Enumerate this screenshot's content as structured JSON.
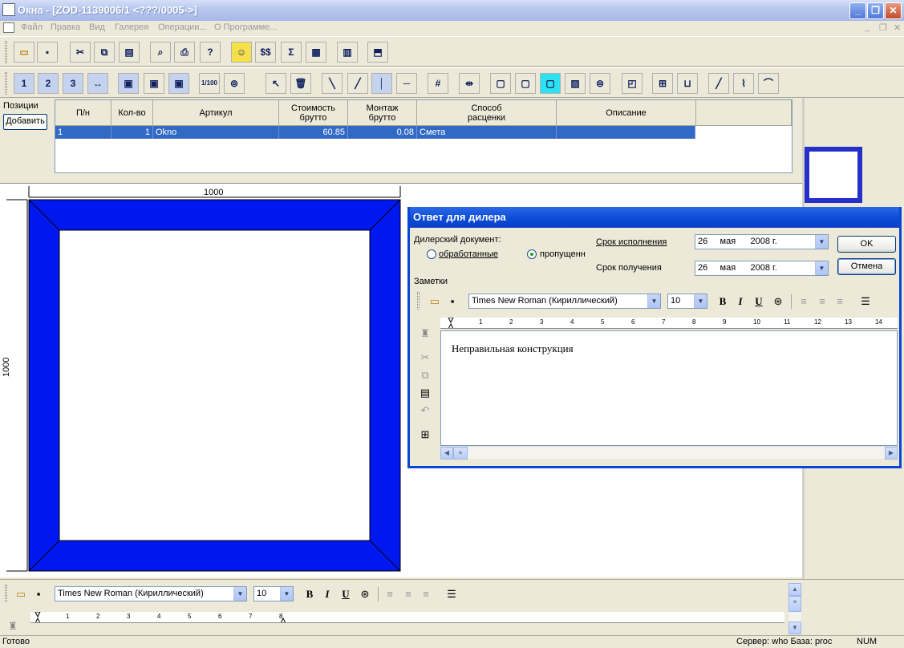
{
  "window": {
    "title": "Окна - [ZOD-1139006/1 <???/0005->]",
    "controls": {
      "minimize": "_",
      "maximize": "❐",
      "close": "✕"
    }
  },
  "menu": {
    "items": [
      "Файл",
      "Правка",
      "Вид",
      "Галерея",
      "Операции...",
      "О Программе..."
    ],
    "mdi_controls": [
      "_",
      "❐",
      "✕"
    ]
  },
  "toolbar1": {
    "icons": [
      "open-folder-icon",
      "save-icon",
      "cut-icon",
      "copy-icon",
      "paste-icon",
      "preview-icon",
      "print-icon",
      "help-icon",
      "face-icon",
      "dollar-icon",
      "sum-icon",
      "grid-icon",
      "calc-icon",
      "export-icon"
    ],
    "dollar_label": "$$",
    "sum_label": "Σ"
  },
  "toolbar2": {
    "number_buttons": [
      "1",
      "2",
      "3"
    ]
  },
  "positions": {
    "label": "Позиции",
    "add_button": "Добавить",
    "columns": [
      "П/н",
      "Кол-во",
      "Артикул",
      "Стоимость\nбрутто",
      "Монтаж\nбрутто",
      "Способ\nрасценки",
      "Описание"
    ],
    "rows": [
      {
        "pn": "1",
        "qty": "1",
        "article": "Okno",
        "cost": "60.85",
        "install": "0.08",
        "method": "Смета",
        "description": ""
      }
    ]
  },
  "drawing": {
    "width_label": "1000",
    "height_label": "1000",
    "frame_color": "#0018f0"
  },
  "dialog": {
    "title": "Ответ для дилера",
    "dealer_doc_label": "Дилерский документ:",
    "radio_processed": "обработанные",
    "radio_skipped": "пропущенн",
    "deadline_label": "Срок исполнения",
    "deadline": {
      "day": "26",
      "month": "мая",
      "year": "2008 г."
    },
    "receive_label": "Срок получения",
    "receive": {
      "day": "26",
      "month": "мая",
      "year": "2008 г."
    },
    "ok": "OK",
    "cancel": "Отмена",
    "notes_label": "Заметки",
    "font": "Times New Roman (Кириллический)",
    "font_size": "10",
    "notes_text": "Неправильная конструкция",
    "ruler_numbers": [
      "1",
      "2",
      "3",
      "4",
      "5",
      "6",
      "7",
      "8",
      "9",
      "10",
      "11",
      "12",
      "13",
      "14"
    ]
  },
  "bottom_editor": {
    "font": "Times New Roman (Кириллический)",
    "font_size": "10",
    "ruler_numbers": [
      "1",
      "2",
      "3",
      "4",
      "5",
      "6",
      "7",
      "8"
    ]
  },
  "status": {
    "left": "Готово",
    "server": "Сервер: who База: proc",
    "num": "NUM"
  },
  "format_buttons": {
    "bold": "B",
    "italic": "I",
    "underline": "U"
  }
}
